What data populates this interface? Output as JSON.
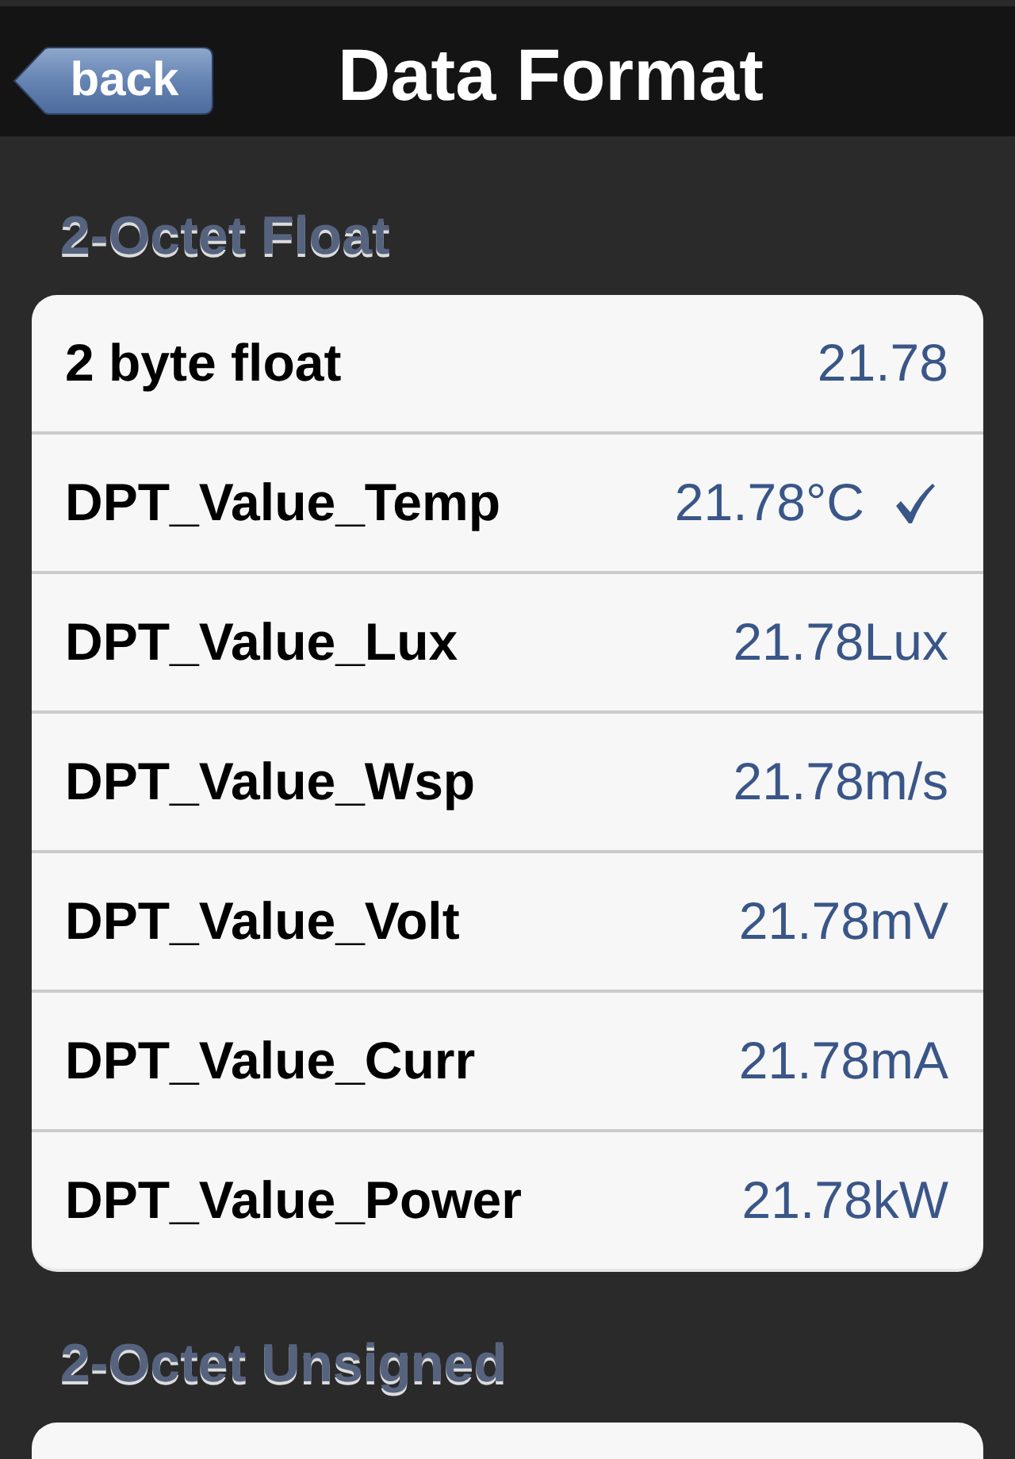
{
  "nav_bar": {
    "back_button": "back",
    "title": "Data Format"
  },
  "sections": [
    {
      "header": "2-Octet Float",
      "rows": [
        {
          "label": "2 byte float",
          "value": "21.78",
          "selected": false
        },
        {
          "label": "DPT_Value_Temp",
          "value": "21.78°C",
          "selected": true
        },
        {
          "label": "DPT_Value_Lux",
          "value": "21.78Lux",
          "selected": false
        },
        {
          "label": "DPT_Value_Wsp",
          "value": "21.78m/s",
          "selected": false
        },
        {
          "label": "DPT_Value_Volt",
          "value": "21.78mV",
          "selected": false
        },
        {
          "label": "DPT_Value_Curr",
          "value": "21.78mA",
          "selected": false
        },
        {
          "label": "DPT_Value_Power",
          "value": "21.78kW",
          "selected": false
        }
      ]
    },
    {
      "header": "2-Octet Unsigned"
    }
  ]
}
